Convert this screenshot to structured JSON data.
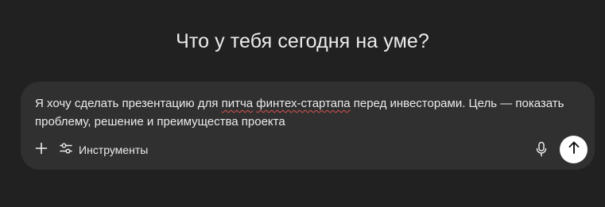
{
  "headline": "Что у тебя сегодня на уме?",
  "composer": {
    "text_parts": {
      "before": "Я хочу сделать презентацию для ",
      "misspelled_1": "питча",
      "space": " ",
      "misspelled_2": "финтех-стартапа",
      "after": " перед инвесторами. Цель — показать проблему, решение и преимущества проекта"
    },
    "tools_label": "Инструменты",
    "icons": {
      "add": "plus-icon",
      "tools": "sliders-icon",
      "mic": "microphone-icon",
      "send": "arrow-up-icon"
    }
  },
  "colors": {
    "background": "#212121",
    "composer_bg": "#303030",
    "text": "#ececec",
    "send_button": "#ffffff",
    "spellcheck": "#d9534f"
  }
}
